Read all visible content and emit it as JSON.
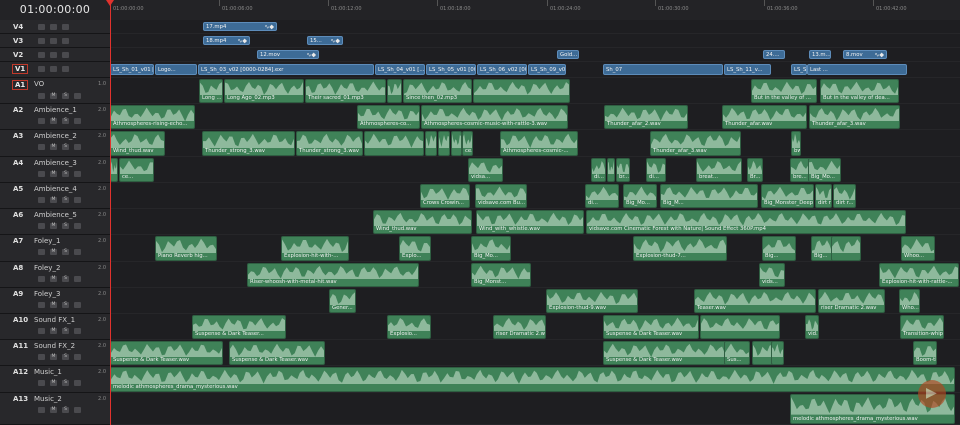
{
  "timecode": "01:00:00:00",
  "ruler": [
    "01:00:00:00",
    "01:00:06:00",
    "01:00:12:00",
    "01:00:18:00",
    "01:00:24:00",
    "01:00:30:00",
    "01:00:36:00",
    "01:00:42:00"
  ],
  "tracks": [
    {
      "id": "V4",
      "name": "",
      "vol": "",
      "kind": "video"
    },
    {
      "id": "V3",
      "name": "",
      "vol": "",
      "kind": "video"
    },
    {
      "id": "V2",
      "name": "",
      "vol": "",
      "kind": "video"
    },
    {
      "id": "V1",
      "name": "",
      "vol": "",
      "kind": "video",
      "selected": true
    },
    {
      "id": "A1",
      "name": "VO",
      "vol": "1.0",
      "kind": "audio",
      "selected": true
    },
    {
      "id": "A2",
      "name": "Ambience_1",
      "vol": "2.0",
      "kind": "audio"
    },
    {
      "id": "A3",
      "name": "Ambience_2",
      "vol": "2.0",
      "kind": "audio"
    },
    {
      "id": "A4",
      "name": "Ambience_3",
      "vol": "2.0",
      "kind": "audio"
    },
    {
      "id": "A5",
      "name": "Ambience_4",
      "vol": "2.0",
      "kind": "audio"
    },
    {
      "id": "A6",
      "name": "Ambience_5",
      "vol": "2.0",
      "kind": "audio"
    },
    {
      "id": "A7",
      "name": "Foley_1",
      "vol": "2.0",
      "kind": "audio"
    },
    {
      "id": "A8",
      "name": "Foley_2",
      "vol": "2.0",
      "kind": "audio"
    },
    {
      "id": "A9",
      "name": "Foley_3",
      "vol": "2.0",
      "kind": "audio"
    },
    {
      "id": "A10",
      "name": "Sound FX_1",
      "vol": "2.0",
      "kind": "audio"
    },
    {
      "id": "A11",
      "name": "Sound FX_2",
      "vol": "2.0",
      "kind": "audio"
    },
    {
      "id": "A12",
      "name": "Music_1",
      "vol": "2.0",
      "kind": "audio"
    },
    {
      "id": "A13",
      "name": "Music_2",
      "vol": "2.0",
      "kind": "audio"
    }
  ],
  "clips": {
    "V4": [
      {
        "label": "17.mp4"
      }
    ],
    "V3": [
      {
        "label": "18.mp4"
      },
      {
        "label": "15..."
      }
    ],
    "V2": [
      {
        "label": "12.mov"
      },
      {
        "label": "Gold..."
      },
      {
        "label": "24...."
      },
      {
        "label": "13.m..."
      },
      {
        "label": "8.mov"
      }
    ],
    "V1": [
      {
        "label": "LS_Sh_01_v01 [..."
      },
      {
        "label": "Logo..."
      },
      {
        "label": "LS_Sh_03_v02 [0000-0284].exr"
      },
      {
        "label": "LS_Sh_04_v01 [..."
      },
      {
        "label": "LS_Sh_05_v01 [000..."
      },
      {
        "label": "LS_Sh_06_v02 [000..."
      },
      {
        "label": "LS_Sh_09_v0..."
      },
      {
        "label": "Sh_07"
      },
      {
        "label": "LS_Sh_11_v..."
      },
      {
        "label": "LS_Sh_13_v01 [0000-0121]..."
      },
      {
        "label": "Last ..."
      }
    ],
    "A1": [
      {
        "label": "Long ..."
      },
      {
        "label": "Long Ago_02.mp3"
      },
      {
        "label": "Their sacred_01.mp3"
      },
      {
        "label": "Since then_02.mp3"
      },
      {
        "label": "But in the valley of ..."
      },
      {
        "label": "But in the valley of dea..."
      }
    ],
    "A2": [
      {
        "label": "Athmospheres-rising-echo..."
      },
      {
        "label": "Athmospheres-co..."
      },
      {
        "label": "Athmospheres-cosmic-music-with-rattle-3.wav"
      },
      {
        "label": "Thunder_afar_2.wav"
      },
      {
        "label": "Thunder_afar.wav"
      },
      {
        "label": "Thunder_afar_3.wav"
      }
    ],
    "A3": [
      {
        "label": "Wind_thud.wav"
      },
      {
        "label": "Thunder_strong_3.wav"
      },
      {
        "label": "Thunder_strong_3.wav"
      },
      {
        "label": "ce..."
      },
      {
        "label": "Athmospheres-cosmic-..."
      },
      {
        "label": "Thunder_afar_3.wav"
      },
      {
        "label": "bw..."
      }
    ],
    "A4": [
      {
        "label": "ce..."
      },
      {
        "label": "vidsa..."
      },
      {
        "label": "di..."
      },
      {
        "label": "br..."
      },
      {
        "label": "di..."
      },
      {
        "label": "breat..."
      },
      {
        "label": "Br..."
      },
      {
        "label": "bre..."
      },
      {
        "label": "Big_Mo..."
      }
    ],
    "A5": [
      {
        "label": "Crows Crowin..."
      },
      {
        "label": "vidsave.com Bu..."
      },
      {
        "label": "di..."
      },
      {
        "label": "Big_Mo..."
      },
      {
        "label": "Big_M..."
      },
      {
        "label": "Big_Monster_Deep_Low_..."
      },
      {
        "label": "dirt r..."
      },
      {
        "label": "dirt r..."
      }
    ],
    "A6": [
      {
        "label": "Wind_thud.wav"
      },
      {
        "label": "Wind_with_whistle.wav"
      },
      {
        "label": "vidsave.com Cinematic Forest with Nature| Sound Effect 360P.mp4"
      }
    ],
    "A7": [
      {
        "label": "Piano Reverb hig..."
      },
      {
        "label": "Explosion-hit-with-..."
      },
      {
        "label": "Explo..."
      },
      {
        "label": "Big_Mo..."
      },
      {
        "label": "Explosion-thud-7..."
      },
      {
        "label": "Big..."
      },
      {
        "label": "Big..."
      },
      {
        "label": "Whoo..."
      }
    ],
    "A8": [
      {
        "label": "Riser-whoosh-with-metal-hit.wav"
      },
      {
        "label": "Big_Monst..."
      },
      {
        "label": "vids..."
      },
      {
        "label": "Explosion-hit-with-rattle-..."
      }
    ],
    "A9": [
      {
        "label": "Gener..."
      },
      {
        "label": "Explosion-thud-9.wav"
      },
      {
        "label": "Teaser.wav"
      },
      {
        "label": "riser Dramatic 2.wav"
      },
      {
        "label": "Who..."
      }
    ],
    "A10": [
      {
        "label": "Suspense & Dark Teaser..."
      },
      {
        "label": "Explosio..."
      },
      {
        "label": "riser Dramatic 2.w..."
      },
      {
        "label": "Suspense & Dark Teaser.wav"
      },
      {
        "label": "vid..."
      },
      {
        "label": "Transition-whip..."
      }
    ],
    "A11": [
      {
        "label": "Suspense & Dark Teaser.wav"
      },
      {
        "label": "Suspense & Dark Teaser.wav"
      },
      {
        "label": "Suspense & Dark Teaser.wav"
      },
      {
        "label": "Sus..."
      },
      {
        "label": "Boom-thu..."
      }
    ],
    "A12": [
      {
        "label": "melodic athmospheres_drama_mysterious.wav"
      }
    ],
    "A13": [
      {
        "label": "melodic athmospheres_drama_mysterious.wav"
      }
    ]
  },
  "icons": {
    "lock": "lock-icon",
    "mute": "mute-icon",
    "solo": "solo-icon",
    "eye": "eye-icon",
    "logo": "davinci-logo-icon"
  },
  "colors": {
    "video_clip": "#3d6b96",
    "audio_clip": "#3f8258",
    "playhead": "#e0322d",
    "selected_track": "#c0392b"
  }
}
